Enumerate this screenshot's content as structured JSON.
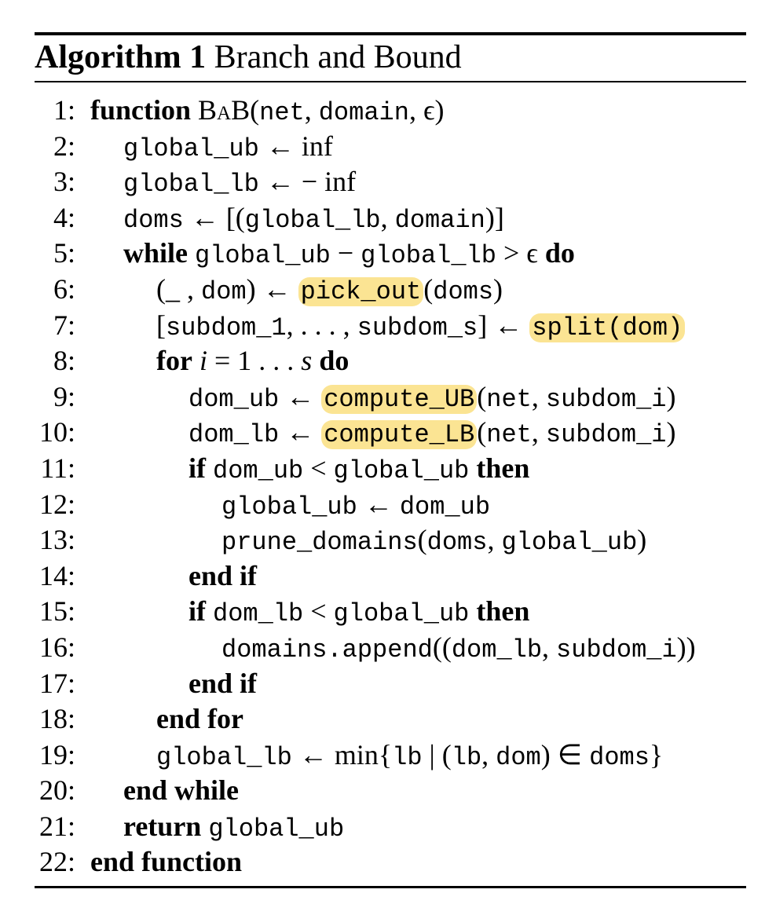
{
  "algorithm": {
    "label": "Algorithm 1",
    "title": "Branch and Bound",
    "highlight_color": "#fbe493",
    "lines": [
      {
        "n": "1:",
        "indent": 0,
        "parts": [
          {
            "t": "function",
            "s": "kw"
          },
          {
            "t": " ",
            "s": "rm"
          },
          {
            "t": "BaB",
            "s": "sc"
          },
          {
            "t": "(",
            "s": "rm"
          },
          {
            "t": "net",
            "s": "tt"
          },
          {
            "t": ", ",
            "s": "rm"
          },
          {
            "t": "domain",
            "s": "tt"
          },
          {
            "t": ", ϵ)",
            "s": "rm"
          }
        ]
      },
      {
        "n": "2:",
        "indent": 1,
        "parts": [
          {
            "t": "global_ub",
            "s": "tt"
          },
          {
            "t": " ← inf",
            "s": "rm"
          }
        ]
      },
      {
        "n": "3:",
        "indent": 1,
        "parts": [
          {
            "t": "global_lb",
            "s": "tt"
          },
          {
            "t": " ← − inf",
            "s": "rm"
          }
        ]
      },
      {
        "n": "4:",
        "indent": 1,
        "parts": [
          {
            "t": "doms",
            "s": "tt"
          },
          {
            "t": " ← [(",
            "s": "rm"
          },
          {
            "t": "global_lb",
            "s": "tt"
          },
          {
            "t": ", ",
            "s": "rm"
          },
          {
            "t": "domain",
            "s": "tt"
          },
          {
            "t": ")]",
            "s": "rm"
          }
        ]
      },
      {
        "n": "5:",
        "indent": 1,
        "parts": [
          {
            "t": "while",
            "s": "kw"
          },
          {
            "t": " ",
            "s": "rm"
          },
          {
            "t": "global_ub",
            "s": "tt"
          },
          {
            "t": " − ",
            "s": "rm"
          },
          {
            "t": "global_lb",
            "s": "tt"
          },
          {
            "t": " > ϵ ",
            "s": "rm"
          },
          {
            "t": "do",
            "s": "kw"
          }
        ]
      },
      {
        "n": "6:",
        "indent": 2,
        "parts": [
          {
            "t": "(_ , ",
            "s": "rm"
          },
          {
            "t": "dom",
            "s": "tt"
          },
          {
            "t": ") ← ",
            "s": "rm"
          },
          {
            "t": "pick_out",
            "s": "tt hl"
          },
          {
            "t": "(",
            "s": "rm"
          },
          {
            "t": "doms",
            "s": "tt"
          },
          {
            "t": ")",
            "s": "rm"
          }
        ]
      },
      {
        "n": "7:",
        "indent": 2,
        "parts": [
          {
            "t": "[",
            "s": "rm"
          },
          {
            "t": "subdom_1",
            "s": "tt"
          },
          {
            "t": ", . . . , ",
            "s": "rm"
          },
          {
            "t": "subdom_s",
            "s": "tt"
          },
          {
            "t": "] ← ",
            "s": "rm"
          },
          {
            "t": "split(dom)",
            "s": "tt hl"
          }
        ]
      },
      {
        "n": "8:",
        "indent": 2,
        "parts": [
          {
            "t": "for",
            "s": "kw"
          },
          {
            "t": " ",
            "s": "rm"
          },
          {
            "t": "i",
            "s": "it"
          },
          {
            "t": " = 1 . . . ",
            "s": "rm"
          },
          {
            "t": "s",
            "s": "it"
          },
          {
            "t": " ",
            "s": "rm"
          },
          {
            "t": "do",
            "s": "kw"
          }
        ]
      },
      {
        "n": "9:",
        "indent": 3,
        "parts": [
          {
            "t": "dom_ub",
            "s": "tt"
          },
          {
            "t": " ← ",
            "s": "rm"
          },
          {
            "t": "compute_UB",
            "s": "tt hl"
          },
          {
            "t": "(",
            "s": "rm"
          },
          {
            "t": "net",
            "s": "tt"
          },
          {
            "t": ", ",
            "s": "rm"
          },
          {
            "t": "subdom_i",
            "s": "tt"
          },
          {
            "t": ")",
            "s": "rm"
          }
        ]
      },
      {
        "n": "10:",
        "indent": 3,
        "parts": [
          {
            "t": "dom_lb",
            "s": "tt"
          },
          {
            "t": " ← ",
            "s": "rm"
          },
          {
            "t": "compute_LB",
            "s": "tt hl"
          },
          {
            "t": "(",
            "s": "rm"
          },
          {
            "t": "net",
            "s": "tt"
          },
          {
            "t": ", ",
            "s": "rm"
          },
          {
            "t": "subdom_i",
            "s": "tt"
          },
          {
            "t": ")",
            "s": "rm"
          }
        ]
      },
      {
        "n": "11:",
        "indent": 3,
        "parts": [
          {
            "t": "if",
            "s": "kw"
          },
          {
            "t": " ",
            "s": "rm"
          },
          {
            "t": "dom_ub",
            "s": "tt"
          },
          {
            "t": " < ",
            "s": "rm"
          },
          {
            "t": "global_ub",
            "s": "tt"
          },
          {
            "t": " ",
            "s": "rm"
          },
          {
            "t": "then",
            "s": "kw"
          }
        ]
      },
      {
        "n": "12:",
        "indent": 4,
        "parts": [
          {
            "t": "global_ub",
            "s": "tt"
          },
          {
            "t": " ← ",
            "s": "rm"
          },
          {
            "t": "dom_ub",
            "s": "tt"
          }
        ]
      },
      {
        "n": "13:",
        "indent": 4,
        "parts": [
          {
            "t": "prune_domains",
            "s": "tt"
          },
          {
            "t": "(",
            "s": "rm"
          },
          {
            "t": "doms",
            "s": "tt"
          },
          {
            "t": ", ",
            "s": "rm"
          },
          {
            "t": "global_ub",
            "s": "tt"
          },
          {
            "t": ")",
            "s": "rm"
          }
        ]
      },
      {
        "n": "14:",
        "indent": 3,
        "parts": [
          {
            "t": "end if",
            "s": "kw"
          }
        ]
      },
      {
        "n": "15:",
        "indent": 3,
        "parts": [
          {
            "t": "if",
            "s": "kw"
          },
          {
            "t": " ",
            "s": "rm"
          },
          {
            "t": "dom_lb",
            "s": "tt"
          },
          {
            "t": " < ",
            "s": "rm"
          },
          {
            "t": "global_ub",
            "s": "tt"
          },
          {
            "t": " ",
            "s": "rm"
          },
          {
            "t": "then",
            "s": "kw"
          }
        ]
      },
      {
        "n": "16:",
        "indent": 4,
        "parts": [
          {
            "t": "domains.append",
            "s": "tt"
          },
          {
            "t": "((",
            "s": "rm"
          },
          {
            "t": "dom_lb",
            "s": "tt"
          },
          {
            "t": ", ",
            "s": "rm"
          },
          {
            "t": "subdom_i",
            "s": "tt"
          },
          {
            "t": "))",
            "s": "rm"
          }
        ]
      },
      {
        "n": "17:",
        "indent": 3,
        "parts": [
          {
            "t": "end if",
            "s": "kw"
          }
        ]
      },
      {
        "n": "18:",
        "indent": 2,
        "parts": [
          {
            "t": "end for",
            "s": "kw"
          }
        ]
      },
      {
        "n": "19:",
        "indent": 2,
        "parts": [
          {
            "t": "global_lb",
            "s": "tt"
          },
          {
            "t": " ← min{",
            "s": "rm"
          },
          {
            "t": "lb",
            "s": "tt"
          },
          {
            "t": " | (",
            "s": "rm"
          },
          {
            "t": "lb",
            "s": "tt"
          },
          {
            "t": ", ",
            "s": "rm"
          },
          {
            "t": "dom",
            "s": "tt"
          },
          {
            "t": ") ∈ ",
            "s": "rm"
          },
          {
            "t": "doms",
            "s": "tt"
          },
          {
            "t": "}",
            "s": "rm"
          }
        ]
      },
      {
        "n": "20:",
        "indent": 1,
        "parts": [
          {
            "t": "end while",
            "s": "kw"
          }
        ]
      },
      {
        "n": "21:",
        "indent": 1,
        "parts": [
          {
            "t": "return",
            "s": "kw"
          },
          {
            "t": " ",
            "s": "rm"
          },
          {
            "t": "global_ub",
            "s": "tt"
          }
        ]
      },
      {
        "n": "22:",
        "indent": 0,
        "parts": [
          {
            "t": "end function",
            "s": "kw"
          }
        ]
      }
    ]
  }
}
